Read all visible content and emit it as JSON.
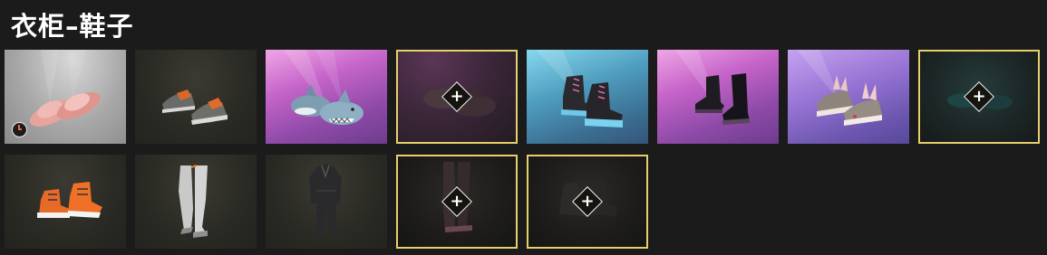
{
  "header": {
    "title": "衣柜–鞋子"
  },
  "wardrobe": {
    "items": [
      {
        "name": "pink-slide-sandals",
        "rarity_bg": "white",
        "locked": false,
        "timed": true
      },
      {
        "name": "orange-grey-sneakers",
        "rarity_bg": "dark",
        "locked": false
      },
      {
        "name": "shark-slippers",
        "rarity_bg": "purple",
        "locked": false
      },
      {
        "name": "dark-shark-slippers",
        "rarity_bg": "dark-purple",
        "locked": true,
        "add_label": "+"
      },
      {
        "name": "blue-sole-combat-boots",
        "rarity_bg": "blue",
        "locked": false
      },
      {
        "name": "black-leather-boots",
        "rarity_bg": "purple",
        "locked": false
      },
      {
        "name": "bunny-sneakers",
        "rarity_bg": "violet",
        "locked": false
      },
      {
        "name": "teal-shoes",
        "rarity_bg": "teal",
        "locked": true,
        "add_label": "+"
      },
      {
        "name": "orange-high-top-sneakers",
        "rarity_bg": "dark",
        "locked": false
      },
      {
        "name": "grey-thigh-high-boots",
        "rarity_bg": "dark",
        "locked": false
      },
      {
        "name": "black-outfit-suit",
        "rarity_bg": "dark",
        "locked": false
      },
      {
        "name": "dark-thigh-high-boots",
        "rarity_bg": "black",
        "locked": true,
        "add_label": "+"
      },
      {
        "name": "dark-ankle-boots",
        "rarity_bg": "black",
        "locked": true,
        "add_label": "+"
      }
    ]
  },
  "colors": {
    "locked_border": "#e7cf6c",
    "background": "#1b1b1b",
    "title": "#ffffff"
  }
}
